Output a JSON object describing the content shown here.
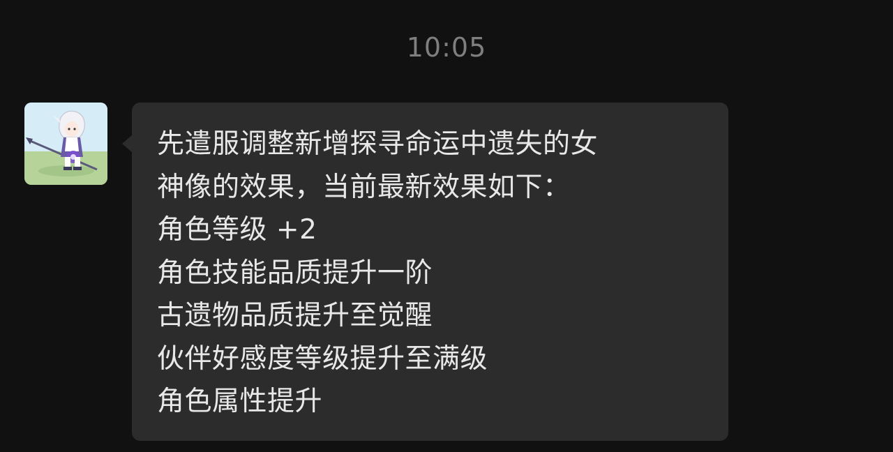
{
  "chat": {
    "timestamp": "10:05",
    "message": {
      "sender_avatar": "anime-character-avatar",
      "lines": [
        "先遣服调整新增探寻命运中遗失的女",
        "神像的效果，当前最新效果如下：",
        "角色等级 +2",
        "角色技能品质提升一阶",
        "古遗物品质提升至觉醒",
        "伙伴好感度等级提升至满级",
        "角色属性提升"
      ]
    }
  },
  "colors": {
    "background": "#111111",
    "bubble": "#2c2c2c",
    "timestamp_text": "#7f7f7f",
    "message_text": "#e8e8e8"
  }
}
